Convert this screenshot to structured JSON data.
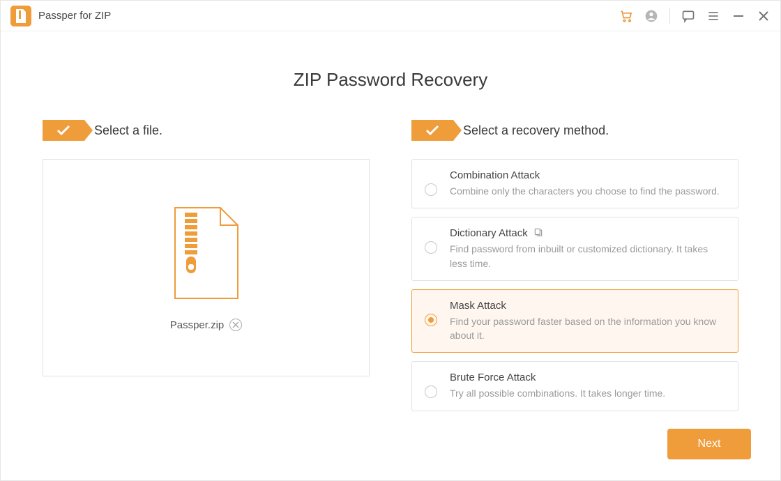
{
  "app": {
    "title": "Passper for ZIP"
  },
  "page": {
    "title": "ZIP Password Recovery"
  },
  "steps": {
    "file": {
      "label": "Select a file."
    },
    "method": {
      "label": "Select a recovery method."
    }
  },
  "file": {
    "name": "Passper.zip"
  },
  "methods": [
    {
      "title": "Combination Attack",
      "desc": "Combine only the characters you choose to find the password.",
      "selected": false,
      "hasSettings": false
    },
    {
      "title": "Dictionary Attack",
      "desc": "Find password from inbuilt or customized dictionary. It takes less time.",
      "selected": false,
      "hasSettings": true
    },
    {
      "title": "Mask Attack",
      "desc": "Find your password faster based on the information you know about it.",
      "selected": true,
      "hasSettings": false
    },
    {
      "title": "Brute Force Attack",
      "desc": "Try all possible combinations. It takes longer time.",
      "selected": false,
      "hasSettings": false
    }
  ],
  "buttons": {
    "next": "Next"
  }
}
